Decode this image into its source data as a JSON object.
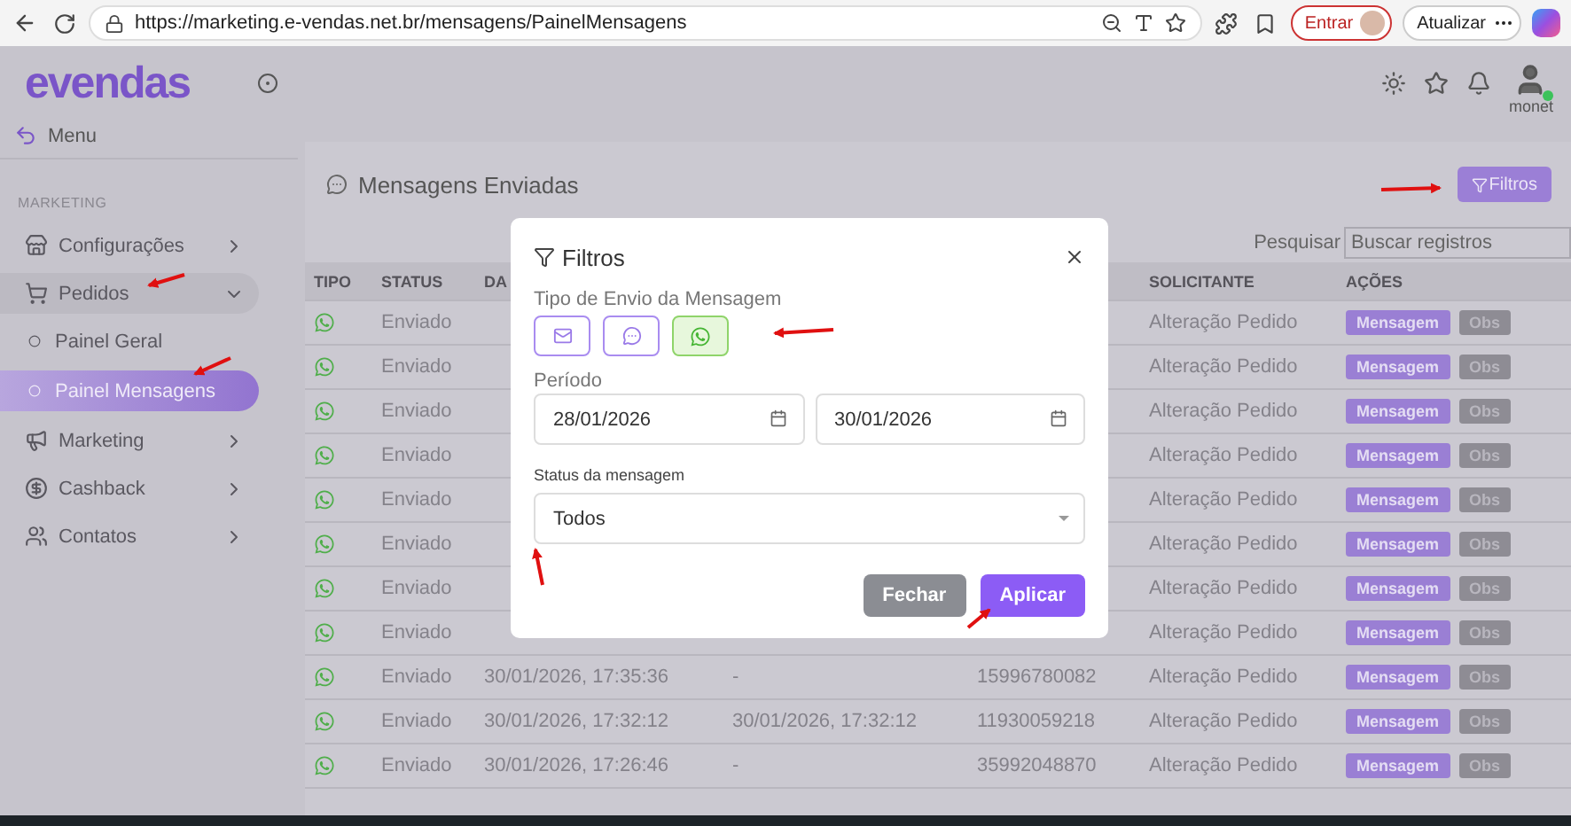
{
  "browser": {
    "url": "https://marketing.e-vendas.net.br/mensagens/PainelMensagens",
    "sign_in": "Entrar",
    "update": "Atualizar"
  },
  "header": {
    "logo": "evendas",
    "user": "monet",
    "online": true
  },
  "sidebar": {
    "menu": "Menu",
    "section": "MARKETING",
    "items": [
      {
        "label": "Configurações",
        "expanded": false
      },
      {
        "label": "Pedidos",
        "expanded": true,
        "children": [
          {
            "label": "Painel Geral",
            "selected": false
          },
          {
            "label": "Painel Mensagens",
            "selected": true
          }
        ]
      },
      {
        "label": "Marketing",
        "expanded": false
      },
      {
        "label": "Cashback",
        "expanded": false
      },
      {
        "label": "Contatos",
        "expanded": false
      }
    ]
  },
  "content": {
    "title": "Mensagens Enviadas",
    "filter_button": "Filtros",
    "search": {
      "label": "Pesquisar",
      "placeholder": "Buscar registros"
    }
  },
  "table": {
    "columns": [
      "TIPO",
      "STATUS",
      "DA",
      "SOLICITANTE",
      "AÇÕES"
    ],
    "rows": [
      {
        "status": "Enviado",
        "solicitante": "Alteração Pedido",
        "actions": [
          "Mensagem",
          "Obs"
        ]
      },
      {
        "status": "Enviado",
        "solicitante": "Alteração Pedido",
        "actions": [
          "Mensagem",
          "Obs"
        ]
      },
      {
        "status": "Enviado",
        "solicitante": "Alteração Pedido",
        "actions": [
          "Mensagem",
          "Obs"
        ]
      },
      {
        "status": "Enviado",
        "solicitante": "Alteração Pedido",
        "actions": [
          "Mensagem",
          "Obs"
        ]
      },
      {
        "status": "Enviado",
        "solicitante": "Alteração Pedido",
        "actions": [
          "Mensagem",
          "Obs"
        ]
      },
      {
        "status": "Enviado",
        "solicitante": "Alteração Pedido",
        "actions": [
          "Mensagem",
          "Obs"
        ]
      },
      {
        "status": "Enviado",
        "solicitante": "Alteração Pedido",
        "actions": [
          "Mensagem",
          "Obs"
        ]
      },
      {
        "status": "Enviado",
        "solicitante": "Alteração Pedido",
        "actions": [
          "Mensagem",
          "Obs"
        ]
      },
      {
        "status": "Enviado",
        "column_3": "30/01/2026, 17:35:36",
        "column_4": "-",
        "column_5": "15996780082",
        "solicitante": "Alteração Pedido",
        "actions": [
          "Mensagem",
          "Obs"
        ]
      },
      {
        "status": "Enviado",
        "column_3": "30/01/2026, 17:32:12",
        "column_4": "30/01/2026, 17:32:12",
        "column_5": "11930059218",
        "solicitante": "Alteração Pedido",
        "actions": [
          "Mensagem",
          "Obs"
        ]
      },
      {
        "status": "Enviado",
        "column_3": "30/01/2026, 17:26:46",
        "column_4": "-",
        "column_5": "35992048870",
        "solicitante": "Alteração Pedido",
        "actions": [
          "Mensagem",
          "Obs"
        ]
      }
    ]
  },
  "modal": {
    "title": "Filtros",
    "type_label": "Tipo de Envio da Mensagem",
    "types": [
      {
        "selected": false
      },
      {
        "selected": false
      },
      {
        "selected": true
      }
    ],
    "period_label": "Período",
    "date_from": "28/01/2026",
    "date_to": "30/01/2026",
    "status_label": "Status da mensagem",
    "status_value": "Todos",
    "close": "Fechar",
    "apply": "Aplicar"
  }
}
